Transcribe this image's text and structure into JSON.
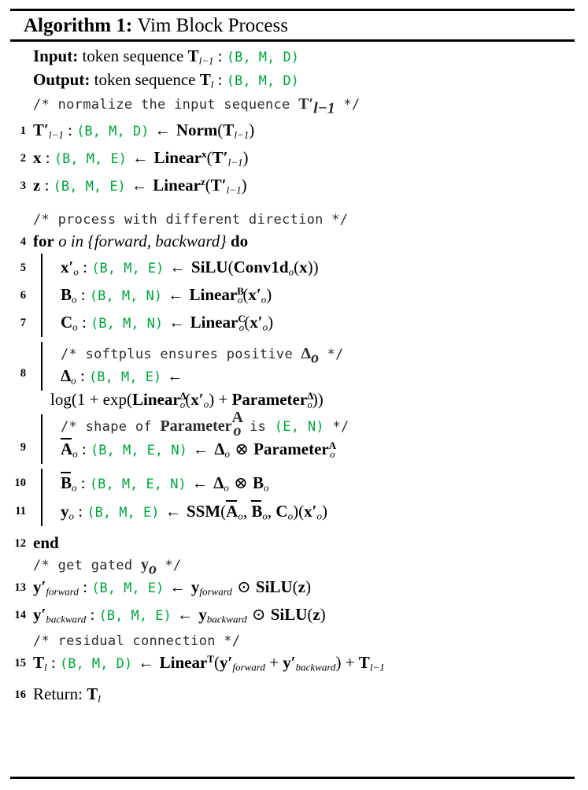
{
  "algorithm": {
    "label": "Algorithm 1:",
    "name": "Vim Block Process",
    "colors": {
      "dimension_green": "#00a33c",
      "text": "#000000",
      "rule": "#000000"
    },
    "io": {
      "input_label": "Input:",
      "input_text": "token sequence",
      "input_var": "T",
      "input_var_sub": "l−1",
      "input_dim": "(B, M, D)",
      "output_label": "Output:",
      "output_text": "token sequence",
      "output_var": "T",
      "output_var_sub": "l",
      "output_dim": "(B, M, D)"
    },
    "comments": {
      "c1": "/* normalize the input sequence",
      "c1_math": "T′",
      "c1_math_sub": "l−1",
      "c1_end": "*/",
      "c2": "/* process with different direction */",
      "c3": "/* softplus ensures positive",
      "c3_math": "Δ",
      "c3_math_sub": "o",
      "c3_end": "*/",
      "c4_a": "/* shape of",
      "c4_math": "Parameter",
      "c4_math_sub": "o",
      "c4_math_sup": "A",
      "c4_b": "is",
      "c4_dim": "(E, N)",
      "c4_end": "*/",
      "c5": "/* get gated",
      "c5_math": "y",
      "c5_math_sub": "o",
      "c5_end": "*/",
      "c6": "/* residual connection */"
    },
    "steps": [
      {
        "n": "1",
        "lhs_var": "T′",
        "lhs_sub": "l−1",
        "dim": "(B, M, D)",
        "arrow": "←",
        "rhs_op": "Norm",
        "rhs_arg": "T",
        "rhs_arg_sub": "l−1"
      },
      {
        "n": "2",
        "lhs_var": "x",
        "dim": "(B, M, E)",
        "arrow": "←",
        "rhs_op": "Linear",
        "rhs_op_sup": "x",
        "rhs_arg": "T′",
        "rhs_arg_sub": "l−1"
      },
      {
        "n": "3",
        "lhs_var": "z",
        "dim": "(B, M, E)",
        "arrow": "←",
        "rhs_op": "Linear",
        "rhs_op_sup": "z",
        "rhs_arg": "T′",
        "rhs_arg_sub": "l−1"
      },
      {
        "n": "4",
        "kw_for": "for",
        "loop_var": "o",
        "kw_in": "in",
        "loop_set": "{forward, backward}",
        "kw_do": "do"
      },
      {
        "n": "5",
        "lhs_var": "x′",
        "lhs_sub": "o",
        "dim": "(B, M, E)",
        "arrow": "←",
        "rhs_op": "SiLU",
        "rhs_inner_op": "Conv1d",
        "rhs_inner_sub": "o",
        "rhs_arg": "x"
      },
      {
        "n": "6",
        "lhs_var": "B",
        "lhs_sub": "o",
        "dim": "(B, M, N)",
        "arrow": "←",
        "rhs_op": "Linear",
        "rhs_op_sub": "o",
        "rhs_op_sup": "B",
        "rhs_arg": "x′",
        "rhs_arg_sub": "o"
      },
      {
        "n": "7",
        "lhs_var": "C",
        "lhs_sub": "o",
        "dim": "(B, M, N)",
        "arrow": "←",
        "rhs_op": "Linear",
        "rhs_op_sub": "o",
        "rhs_op_sup": "C",
        "rhs_arg": "x′",
        "rhs_arg_sub": "o"
      },
      {
        "n": "8",
        "lhs_var": "Δ",
        "lhs_sub": "o",
        "dim": "(B, M, E)",
        "arrow": "←",
        "cont_prefix": "log(1 + exp(",
        "cont_op1": "Linear",
        "cont_op1_sub": "o",
        "cont_op1_sup": "Δ",
        "cont_arg1": "x′",
        "cont_arg1_sub": "o",
        "cont_plus": "+",
        "cont_op2": "Parameter",
        "cont_op2_sub": "o",
        "cont_op2_sup": "Δ",
        "cont_suffix": "))"
      },
      {
        "n": "9",
        "lhs_var": "A",
        "lhs_sub": "o",
        "lhs_overline": true,
        "dim": "(B, M, E, N)",
        "arrow": "←",
        "rhs_a": "Δ",
        "rhs_a_sub": "o",
        "rhs_sym": "⊗",
        "rhs_b": "Parameter",
        "rhs_b_sub": "o",
        "rhs_b_sup": "A"
      },
      {
        "n": "10",
        "lhs_var": "B",
        "lhs_sub": "o",
        "lhs_overline": true,
        "dim": "(B, M, E, N)",
        "arrow": "←",
        "rhs_a": "Δ",
        "rhs_a_sub": "o",
        "rhs_sym": "⊗",
        "rhs_b": "B",
        "rhs_b_sub": "o"
      },
      {
        "n": "11",
        "lhs_var": "y",
        "lhs_sub": "o",
        "dim": "(B, M, E)",
        "arrow": "←",
        "rhs_op": "SSM",
        "rhs_args": "(A̅o, B̅o, Co)(x′o)"
      },
      {
        "n": "12",
        "kw_end": "end"
      },
      {
        "n": "13",
        "lhs_var": "y′",
        "lhs_sub": "forward",
        "dim": "(B, M, E)",
        "arrow": "←",
        "rhs_a": "y",
        "rhs_a_sub": "forward",
        "rhs_sym": "⊙",
        "rhs_op": "SiLU",
        "rhs_arg": "z"
      },
      {
        "n": "14",
        "lhs_var": "y′",
        "lhs_sub": "backward",
        "dim": "(B, M, E)",
        "arrow": "←",
        "rhs_a": "y",
        "rhs_a_sub": "backward",
        "rhs_sym": "⊙",
        "rhs_op": "SiLU",
        "rhs_arg": "z"
      },
      {
        "n": "15",
        "lhs_var": "T",
        "lhs_sub": "l",
        "dim": "(B, M, D)",
        "arrow": "←",
        "rhs_op": "Linear",
        "rhs_op_sup": "T",
        "rhs_arg1": "y′",
        "rhs_arg1_sub": "forward",
        "rhs_plus": "+",
        "rhs_arg2": "y′",
        "rhs_arg2_sub": "backward",
        "rhs_tail_plus": "+",
        "rhs_tail": "T",
        "rhs_tail_sub": "l−1"
      },
      {
        "n": "16",
        "return_label": "Return:",
        "return_var": "T",
        "return_var_sub": "l"
      }
    ]
  }
}
